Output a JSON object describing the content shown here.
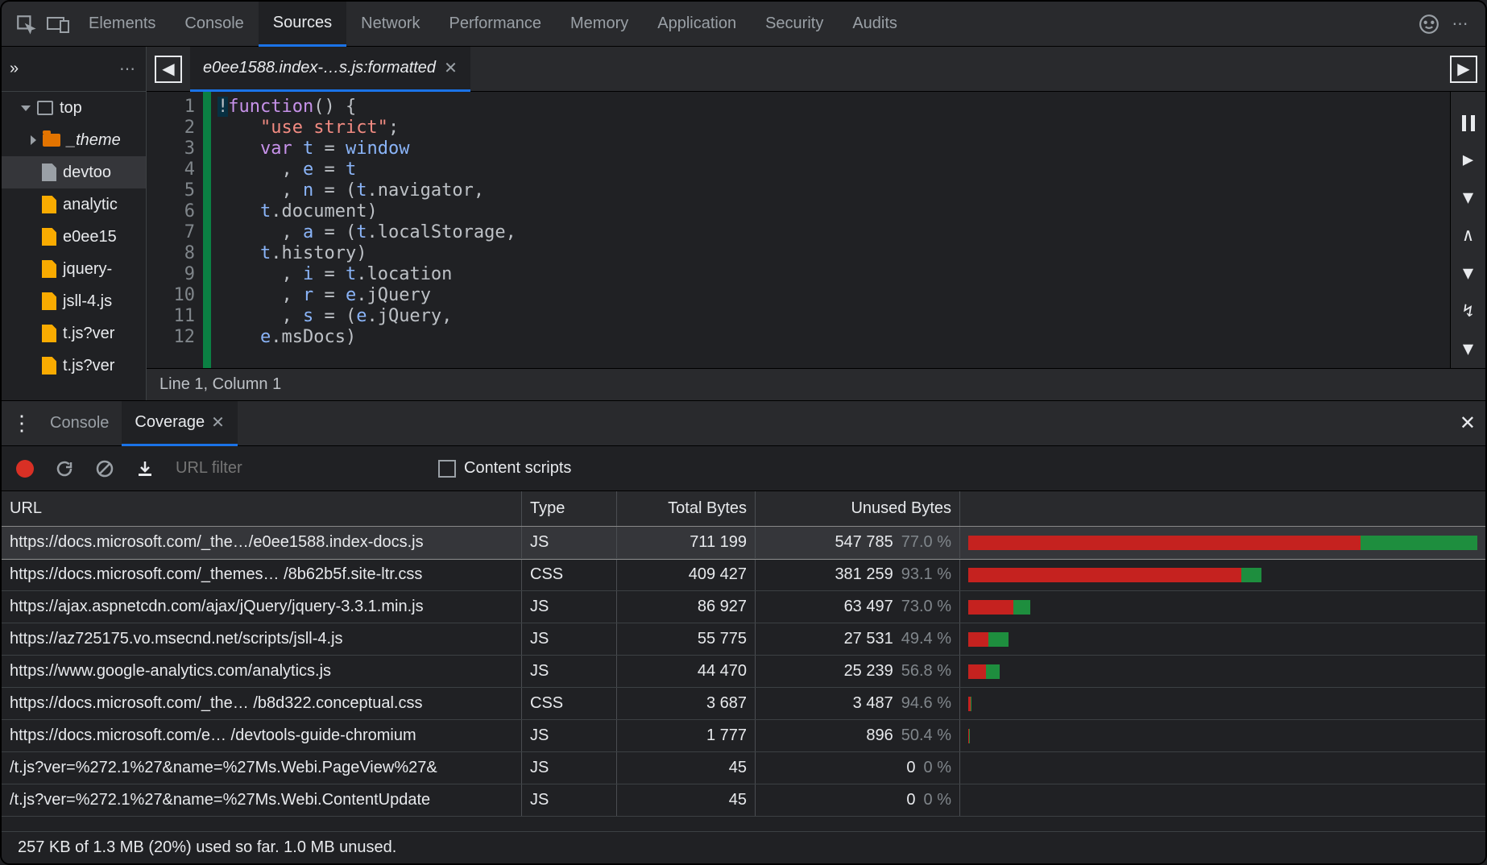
{
  "top_tabs": {
    "items": [
      "Elements",
      "Console",
      "Sources",
      "Network",
      "Performance",
      "Memory",
      "Application",
      "Security",
      "Audits"
    ],
    "active": "Sources"
  },
  "sidebar": {
    "root": "top",
    "folder": "_theme",
    "files": [
      "devtoo",
      "analytic",
      "e0ee15",
      "jquery-",
      "jsll-4.js",
      "t.js?ver",
      "t.js?ver"
    ]
  },
  "editor": {
    "tab": "e0ee1588.index-…s.js:formatted",
    "status": "Line 1, Column 1",
    "lines": [
      "!",
      "function",
      "() {",
      "    ",
      "\"use strict\"",
      ";",
      "    ",
      "var",
      " ",
      "t",
      " = ",
      "window",
      "",
      "      , ",
      "e",
      " = ",
      "t",
      "",
      "      , ",
      "n",
      " = (",
      "t",
      ".navigator,",
      "    ",
      "t",
      ".document)",
      "      , ",
      "a",
      " = (",
      "t",
      ".localStorage,",
      "    ",
      "t",
      ".history)",
      "      , ",
      "i",
      " = ",
      "t",
      ".location",
      "      , ",
      "r",
      " = ",
      "e",
      ".jQuery",
      "      , ",
      "s",
      " = (",
      "e",
      ".jQuery,",
      "    ",
      "e",
      ".msDocs)"
    ]
  },
  "drawer": {
    "tabs": [
      "Console",
      "Coverage"
    ],
    "active": "Coverage",
    "filter_placeholder": "URL filter",
    "content_scripts_label": "Content scripts"
  },
  "coverage": {
    "headers": {
      "url": "URL",
      "type": "Type",
      "total": "Total Bytes",
      "unused": "Unused Bytes"
    },
    "rows": [
      {
        "url": "https://docs.microsoft.com/_the…/e0ee1588.index-docs.js",
        "type": "JS",
        "total": "711 199",
        "unused": "547 785",
        "pct": "77.0 %",
        "red": 77.0,
        "green": 23.0,
        "scale": 100,
        "sel": true
      },
      {
        "url": "https://docs.microsoft.com/_themes… /8b62b5f.site-ltr.css",
        "type": "CSS",
        "total": "409 427",
        "unused": "381 259",
        "pct": "93.1 %",
        "red": 53.6,
        "green": 4.0,
        "scale": 57.6
      },
      {
        "url": "https://ajax.aspnetcdn.com/ajax/jQuery/jquery-3.3.1.min.js",
        "type": "JS",
        "total": "86 927",
        "unused": "63 497",
        "pct": "73.0 %",
        "red": 8.9,
        "green": 3.3,
        "scale": 12.2
      },
      {
        "url": "https://az725175.vo.msecnd.net/scripts/jsll-4.js",
        "type": "JS",
        "total": "55 775",
        "unused": "27 531",
        "pct": "49.4 %",
        "red": 3.9,
        "green": 4.0,
        "scale": 7.9
      },
      {
        "url": "https://www.google-analytics.com/analytics.js",
        "type": "JS",
        "total": "44 470",
        "unused": "25 239",
        "pct": "56.8 %",
        "red": 3.5,
        "green": 2.7,
        "scale": 6.2
      },
      {
        "url": "https://docs.microsoft.com/_the… /b8d322.conceptual.css",
        "type": "CSS",
        "total": "3 687",
        "unused": "3 487",
        "pct": "94.6 %",
        "red": 0.5,
        "green": 0.05,
        "scale": 0.55
      },
      {
        "url": "https://docs.microsoft.com/e…  /devtools-guide-chromium",
        "type": "JS",
        "total": "1 777",
        "unused": "896",
        "pct": "50.4 %",
        "red": 0.15,
        "green": 0.15,
        "scale": 0.3
      },
      {
        "url": "/t.js?ver=%272.1%27&name=%27Ms.Webi.PageView%27&",
        "type": "JS",
        "total": "45",
        "unused": "0",
        "pct": "0 %",
        "red": 0,
        "green": 0,
        "scale": 0
      },
      {
        "url": "/t.js?ver=%272.1%27&name=%27Ms.Webi.ContentUpdate",
        "type": "JS",
        "total": "45",
        "unused": "0",
        "pct": "0 %",
        "red": 0,
        "green": 0,
        "scale": 0
      }
    ],
    "summary": "257 KB of 1.3 MB (20%) used so far. 1.0 MB unused."
  }
}
